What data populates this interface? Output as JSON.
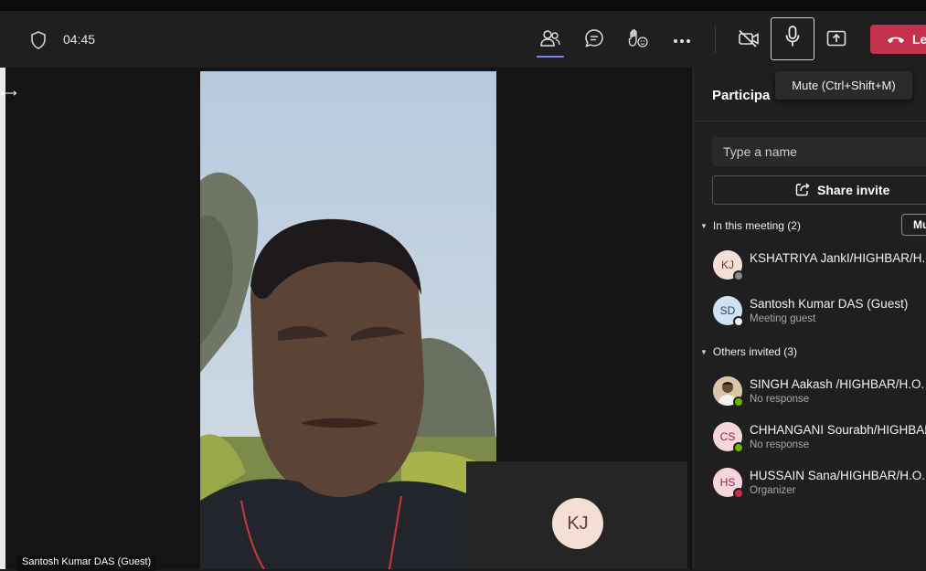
{
  "toolbar": {
    "timer": "04:45",
    "leave_label": "Le",
    "mic_tooltip": "Mute (Ctrl+Shift+M)",
    "icons": [
      "shield-icon",
      "people-icon",
      "chat-icon",
      "raise-hand-icon",
      "more-icon",
      "camera-off-icon",
      "mic-icon",
      "share-screen-icon",
      "phone-hangup-icon"
    ],
    "colors": {
      "leave": "#c4314b",
      "active_indicator": "#7f85f5"
    }
  },
  "stage": {
    "video_name": "Santosh Kumar DAS (Guest)",
    "pip_initials": "KJ"
  },
  "panel": {
    "title": "Participa",
    "search_placeholder": "Type a name",
    "share_label": "Share invite",
    "in_meeting_label": "In this meeting (2)",
    "mute_all_label": "Mu",
    "others_label": "Others invited (3)",
    "in_meeting": [
      {
        "initials": "KJ",
        "name": "KSHATRIYA JankI/HIGHBAR/H.O.",
        "status": "",
        "avatar_color": "#f3dfd6",
        "initials_color": "#6b3b2a",
        "presence": "offline"
      },
      {
        "initials": "SD",
        "name": "Santosh Kumar DAS (Guest)",
        "status": "Meeting guest",
        "avatar_color": "#cfe2f3",
        "initials_color": "#2b4a6b",
        "presence": "unknown"
      }
    ],
    "others": [
      {
        "initials": "",
        "name": "SINGH Aakash /HIGHBAR/H.O.",
        "status": "No response",
        "avatar_color": "#c9a77c",
        "initials_color": "#3a2a1a",
        "presence": "available"
      },
      {
        "initials": "CS",
        "name": "CHHANGANI Sourabh/HIGHBAR",
        "status": "No response",
        "avatar_color": "#f6d5dc",
        "initials_color": "#8a2c40",
        "presence": "available"
      },
      {
        "initials": "HS",
        "name": "HUSSAIN Sana/HIGHBAR/H.O.",
        "status": "Organizer",
        "avatar_color": "#f6d5dc",
        "initials_color": "#8a2c40",
        "presence": "busy"
      }
    ]
  }
}
